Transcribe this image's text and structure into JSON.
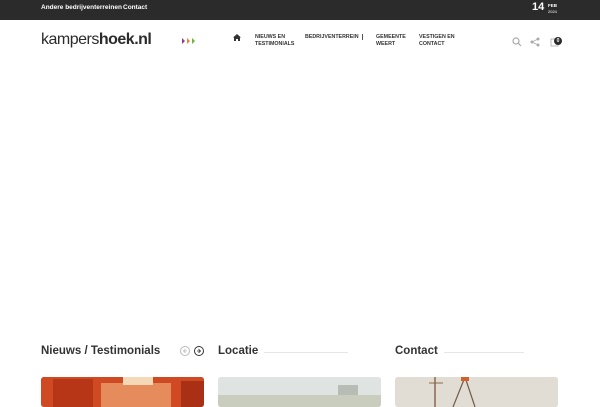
{
  "topbar": {
    "links": [
      "Andere bedrijventerreinen",
      "Contact"
    ],
    "date": {
      "day": "14",
      "month": "FEB",
      "year": "2024"
    }
  },
  "header": {
    "logo": {
      "part1": "kampers",
      "part2": "hoek",
      "part3": ".nl"
    },
    "nav": [
      {
        "icon": "home-icon"
      },
      {
        "label": "NIEUWS EN TESTIMONIALS"
      },
      {
        "label": "BEDRIJVENTERREIN"
      },
      {
        "label": "GEMEENTE WEERT"
      },
      {
        "label": "VESTIGEN EN CONTACT"
      }
    ],
    "icons": [
      "search-icon",
      "share-icon",
      "cart-icon"
    ],
    "cart_count": "0"
  },
  "sections": [
    {
      "title": "Nieuws / Testimonials"
    },
    {
      "title": "Locatie"
    },
    {
      "title": "Contact"
    }
  ],
  "colors": {
    "topbar_bg": "#2b2b2b",
    "text_dark": "#333333",
    "logo_green": "#6fb23e",
    "logo_purple": "#8e3f8f",
    "logo_orange": "#e8872b"
  }
}
